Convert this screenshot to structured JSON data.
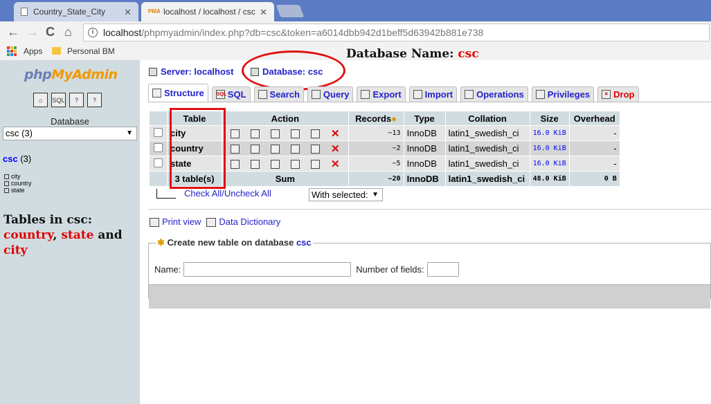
{
  "browser": {
    "tabs": [
      {
        "title": "Country_State_City",
        "close": "✕"
      },
      {
        "title": "localhost / localhost / csc",
        "close": "✕"
      }
    ],
    "nav": {
      "back": "←",
      "forward": "→",
      "reload": "C",
      "home": "⌂"
    },
    "address": {
      "host": "localhost",
      "path": "/phpmyadmin/index.php?db=csc&token=a6014dbb942d1beff5d63942b881e738"
    },
    "bookmarks": [
      {
        "label": "Apps"
      },
      {
        "label": "Personal BM"
      }
    ]
  },
  "leftframe": {
    "logo": {
      "php": "php",
      "myadmin": "MyAdmin"
    },
    "icons": [
      "home-icon",
      "sql-icon",
      "query-window-icon",
      "docs-icon"
    ],
    "database_label": "Database",
    "database_select": "csc (3)",
    "db_link": {
      "name": "csc",
      "count": "(3)"
    },
    "tables": [
      "city",
      "country",
      "state"
    ]
  },
  "annotations": {
    "title_prefix": "Database Name:",
    "title_db": "csc",
    "left_line1": "Tables in csc:",
    "left_country": "country",
    "left_state": "state",
    "left_and": "and",
    "left_city": "city",
    "comma": ","
  },
  "breadcrumb": {
    "server": "Server: localhost",
    "separator": "›",
    "database": "Database: csc"
  },
  "tabs": [
    {
      "label": "Structure",
      "icon": "structure-icon"
    },
    {
      "label": "SQL",
      "icon": "sql-icon"
    },
    {
      "label": "Search",
      "icon": "search-icon"
    },
    {
      "label": "Query",
      "icon": "query-icon"
    },
    {
      "label": "Export",
      "icon": "export-icon"
    },
    {
      "label": "Import",
      "icon": "import-icon"
    },
    {
      "label": "Operations",
      "icon": "operations-icon"
    },
    {
      "label": "Privileges",
      "icon": "privileges-icon"
    },
    {
      "label": "Drop",
      "icon": "drop-icon"
    }
  ],
  "table": {
    "headers": {
      "table": "Table",
      "action": "Action",
      "records": "Records",
      "type": "Type",
      "collation": "Collation",
      "size": "Size",
      "overhead": "Overhead"
    },
    "rows": [
      {
        "name": "city",
        "records": "~13",
        "type": "InnoDB",
        "collation": "latin1_swedish_ci",
        "size": "16.0 KiB",
        "overhead": "-"
      },
      {
        "name": "country",
        "records": "~2",
        "type": "InnoDB",
        "collation": "latin1_swedish_ci",
        "size": "16.0 KiB",
        "overhead": "-"
      },
      {
        "name": "state",
        "records": "~5",
        "type": "InnoDB",
        "collation": "latin1_swedish_ci",
        "size": "16.0 KiB",
        "overhead": "-"
      }
    ],
    "sum": {
      "tables": "3 table(s)",
      "label": "Sum",
      "records": "~20",
      "type": "InnoDB",
      "collation": "latin1_swedish_ci",
      "size": "48.0 KiB",
      "overhead": "0 B"
    },
    "delete_glyph": "✕"
  },
  "bulk": {
    "check_all": "Check All",
    "separator": " / ",
    "uncheck_all": "Uncheck All",
    "with_selected": "With selected:"
  },
  "links": {
    "print_view": "Print view",
    "data_dictionary": "Data Dictionary"
  },
  "create_table": {
    "legend_prefix": "Create new table on database",
    "db": "csc",
    "name_label": "Name:",
    "fields_label": "Number of fields:"
  }
}
